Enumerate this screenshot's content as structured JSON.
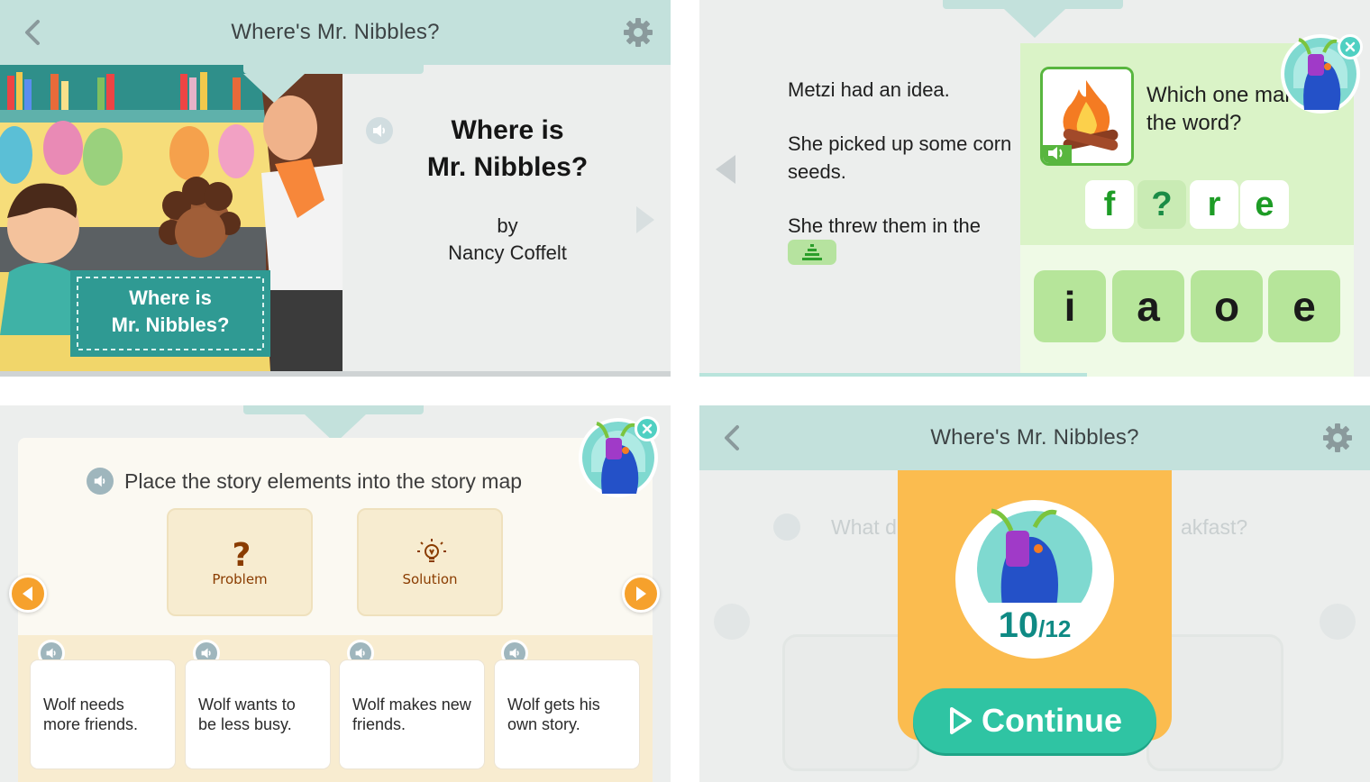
{
  "panel1": {
    "header": {
      "title": "Where's Mr. Nibbles?"
    },
    "book": {
      "title_line1": "Where is",
      "title_line2": "Mr. Nibbles?",
      "by": "by",
      "author": "Nancy Coffelt",
      "cover_sign_line1": "Where is",
      "cover_sign_line2": "Mr. Nibbles?"
    }
  },
  "panel2": {
    "story": {
      "line1": "Metzi had an idea.",
      "line2": "She picked up some corn seeds.",
      "line3": "She threw them in the"
    },
    "quiz": {
      "question": "Which one makes the word?",
      "word_letters": [
        "f",
        "?",
        "r",
        "e"
      ],
      "choices": [
        "i",
        "a",
        "o",
        "e"
      ]
    }
  },
  "panel3": {
    "instruction": "Place the story elements into the story map",
    "slots": [
      {
        "label": "Problem",
        "icon": "question-mark-icon"
      },
      {
        "label": "Solution",
        "icon": "lightbulb-icon"
      }
    ],
    "elements": [
      "Wolf needs more friends.",
      "Wolf wants to be less busy.",
      "Wolf makes new friends.",
      "Wolf gets his own story."
    ]
  },
  "panel4": {
    "header": {
      "title": "Where's Mr. Nibbles?"
    },
    "ghost_question_left": "What d",
    "ghost_question_right": "akfast?",
    "score": {
      "value": "10",
      "total": "/12"
    },
    "continue_label": "Continue"
  },
  "colors": {
    "header_teal": "#c3e1dc",
    "quiz_green": "#daf3c7",
    "choice_green": "#b6e59a",
    "orange": "#fbbc4f",
    "continue_teal": "#2fc4a3",
    "nav_orange": "#f6a12c"
  }
}
